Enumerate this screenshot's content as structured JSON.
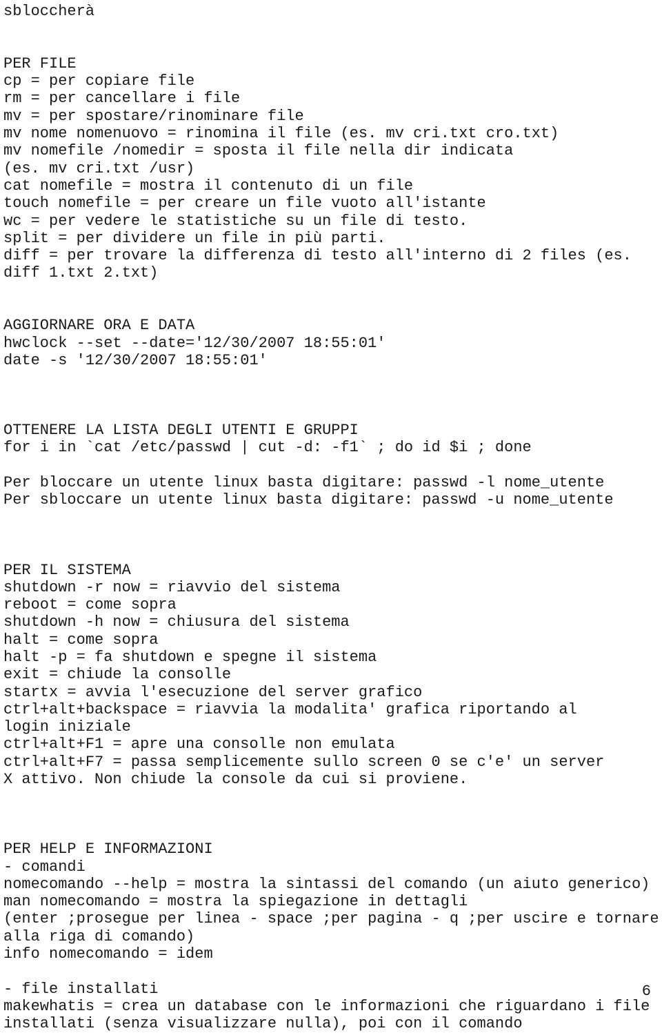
{
  "document": {
    "page_number": "6",
    "language": "it",
    "lines": [
      "sbloccherà",
      "",
      "",
      "PER FILE",
      "cp = per copiare file",
      "rm = per cancellare i file",
      "mv = per spostare/rinominare file",
      "mv nome nomenuovo = rinomina il file (es. mv cri.txt cro.txt)",
      "mv nomefile /nomedir = sposta il file nella dir indicata",
      "(es. mv cri.txt /usr)",
      "cat nomefile = mostra il contenuto di un file",
      "touch nomefile = per creare un file vuoto all'istante",
      "wc = per vedere le statistiche su un file di testo.",
      "split = per dividere un file in più parti.",
      "diff = per trovare la differenza di testo all'interno di 2 files (es.",
      "diff 1.txt 2.txt)",
      "",
      "",
      "AGGIORNARE ORA E DATA",
      "hwclock --set --date='12/30/2007 18:55:01'",
      "date -s '12/30/2007 18:55:01'",
      "",
      "",
      "",
      "OTTENERE LA LISTA DEGLI UTENTI E GRUPPI",
      "for i in `cat /etc/passwd | cut -d: -f1` ; do id $i ; done",
      "",
      "Per bloccare un utente linux basta digitare: passwd -l nome_utente",
      "Per sbloccare un utente linux basta digitare: passwd -u nome_utente",
      "",
      "",
      "",
      "PER IL SISTEMA",
      "shutdown -r now = riavvio del sistema",
      "reboot = come sopra",
      "shutdown -h now = chiusura del sistema",
      "halt = come sopra",
      "halt -p = fa shutdown e spegne il sistema",
      "exit = chiude la consolle",
      "startx = avvia l'esecuzione del server grafico",
      "ctrl+alt+backspace = riavvia la modalita' grafica riportando al",
      "login iniziale",
      "ctrl+alt+F1 = apre una consolle non emulata",
      "ctrl+alt+F7 = passa semplicemente sullo screen 0 se c'e' un server",
      "X attivo. Non chiude la console da cui si proviene.",
      "",
      "",
      "",
      "PER HELP E INFORMAZIONI",
      "- comandi",
      "nomecomando --help = mostra la sintassi del comando (un aiuto generico)",
      "man nomecomando = mostra la spiegazione in dettagli",
      "(enter ;prosegue per linea - space ;per pagina - q ;per uscire e tornare",
      "alla riga di comando)",
      "info nomecomando = idem",
      "",
      "- file installati",
      "makewhatis = crea un database con le informazioni che riguardano i file",
      "installati (senza visualizzare nulla), poi con il comando"
    ]
  }
}
